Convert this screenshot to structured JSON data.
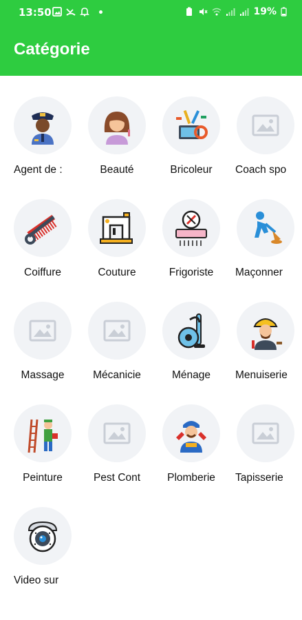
{
  "status_bar": {
    "time": "13:50",
    "battery": "19%",
    "icons": [
      "image-icon",
      "missed-call-icon",
      "bell-icon",
      "dot-icon",
      "battery-saver-icon",
      "mute-icon",
      "wifi-icon",
      "signal-icon",
      "signal-icon",
      "battery-icon"
    ]
  },
  "app_bar": {
    "title": "Catégorie"
  },
  "colors": {
    "primary": "#2ecc40",
    "circle_bg": "#f1f3f6",
    "placeholder": "#c9ced6"
  },
  "categories": [
    {
      "label": "Agent de :",
      "icon": "security-guard-icon"
    },
    {
      "label": "Beauté",
      "icon": "woman-beauty-icon"
    },
    {
      "label": "Bricoleur",
      "icon": "tools-icon"
    },
    {
      "label": "Coach spo",
      "icon": "image-placeholder-icon"
    },
    {
      "label": "Coiffure",
      "icon": "scissors-comb-icon"
    },
    {
      "label": "Couture",
      "icon": "sewing-machine-icon"
    },
    {
      "label": "Frigoriste",
      "icon": "air-conditioner-icon"
    },
    {
      "label": "Maçonner",
      "icon": "mason-worker-icon"
    },
    {
      "label": "Massage",
      "icon": "image-placeholder-icon"
    },
    {
      "label": "Mécanicie",
      "icon": "image-placeholder-icon"
    },
    {
      "label": "Ménage",
      "icon": "vacuum-cleaner-icon"
    },
    {
      "label": "Menuiserie",
      "icon": "carpenter-icon"
    },
    {
      "label": "Peinture",
      "icon": "painter-icon"
    },
    {
      "label": "Pest Cont",
      "icon": "image-placeholder-icon"
    },
    {
      "label": "Plomberie",
      "icon": "plumber-icon"
    },
    {
      "label": "Tapisserie",
      "icon": "image-placeholder-icon"
    },
    {
      "label": "Video sur",
      "icon": "security-camera-icon"
    }
  ]
}
